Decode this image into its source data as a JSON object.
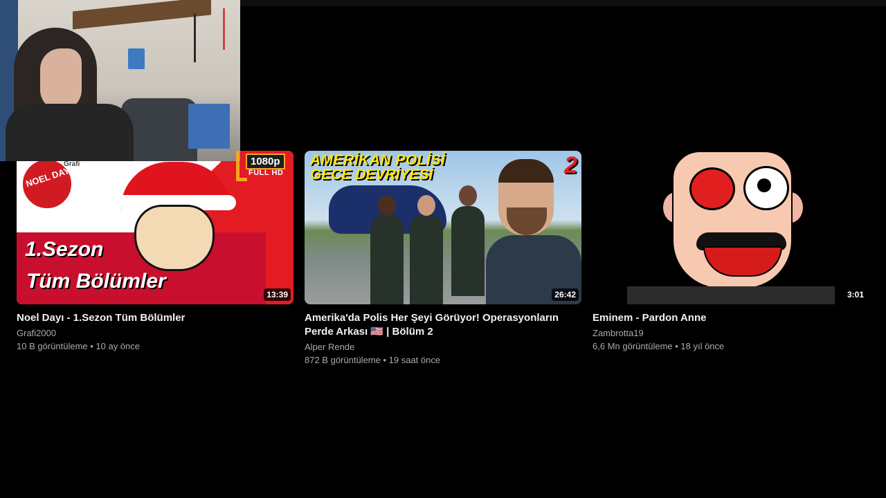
{
  "hd_badge": {
    "resolution": "1080p",
    "label": "FULL HD"
  },
  "videos": [
    {
      "title": "Noel Dayı - 1.Sezon Tüm Bölümler",
      "channel": "Grafi2000",
      "meta": "10 B görüntüleme • 10 ay önce",
      "duration": "13:39",
      "thumb_text": {
        "logo": "NOEL DAYI",
        "brand": "Grafi",
        "line1": "1.Sezon",
        "line2": "Tüm Bölümler"
      }
    },
    {
      "title": "Amerika'da Polis Her Şeyi Görüyor! Operasyonların Perde Arkası 🇺🇸 | Bölüm 2",
      "channel": "Alper Rende",
      "meta": "872 B görüntüleme • 19 saat önce",
      "duration": "26:42",
      "thumb_text": {
        "line1": "AMERİKAN POLİSİ",
        "line2": "GECE DEVRİYESİ",
        "number": "2"
      }
    },
    {
      "title": "Eminem - Pardon Anne",
      "channel": "Zambrotta19",
      "meta": "6,6 Mn görüntüleme • 18 yıl önce",
      "duration": "3:01"
    }
  ]
}
